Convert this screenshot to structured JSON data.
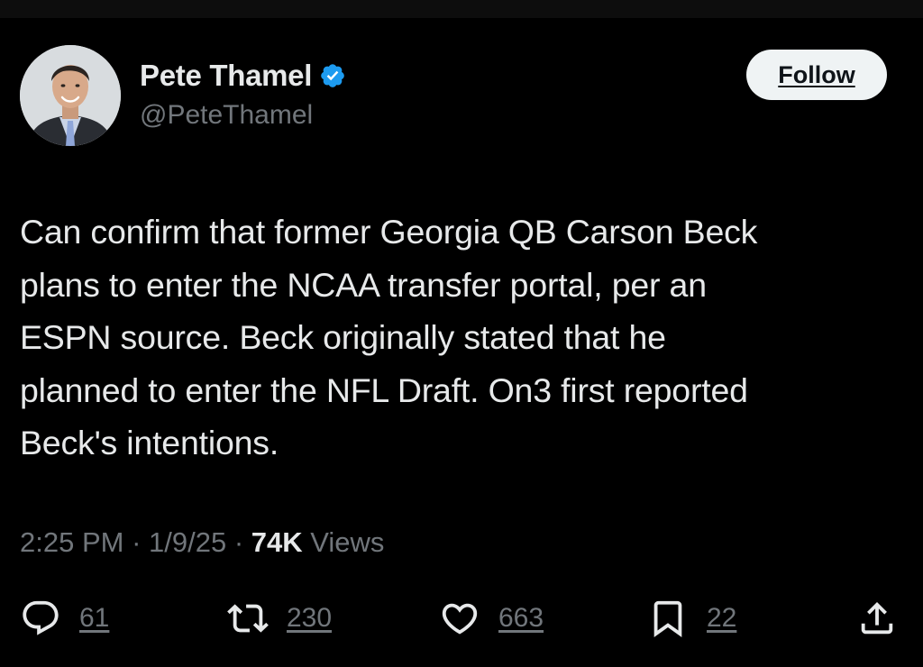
{
  "author": {
    "display_name": "Pete Thamel",
    "handle": "@PeteThamel",
    "verified": true,
    "verified_color": "#1d9bf0"
  },
  "follow_button": {
    "label": "Follow"
  },
  "tweet": {
    "lines": [
      "Can confirm that former Georgia QB Carson Beck",
      "plans to enter the NCAA transfer portal, per an",
      "ESPN source. Beck originally stated that he",
      "planned to enter the NFL Draft. On3 first reported",
      "Beck's intentions."
    ]
  },
  "meta": {
    "time": "2:25 PM",
    "separator": " · ",
    "date": "1/9/25",
    "views_count": "74K",
    "views_label": " Views"
  },
  "actions": {
    "reply": {
      "icon": "reply-icon",
      "count": "61"
    },
    "repost": {
      "icon": "repost-icon",
      "count": "230"
    },
    "like": {
      "icon": "heart-icon",
      "count": "663"
    },
    "bookmark": {
      "icon": "bookmark-icon",
      "count": "22"
    },
    "share": {
      "icon": "share-icon"
    }
  },
  "colors": {
    "background": "#000000",
    "primary_text": "#e7e9ea",
    "secondary_text": "#71767b",
    "follow_bg": "#eff3f4"
  }
}
